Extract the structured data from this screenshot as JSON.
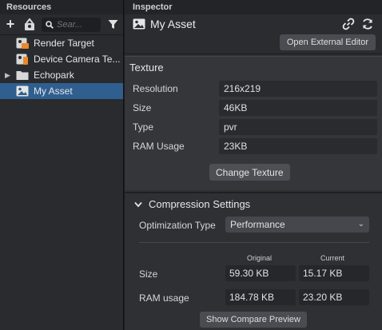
{
  "resources": {
    "title": "Resources",
    "search_placeholder": "Sear...",
    "items": [
      {
        "label": "Render Target",
        "icon": "render-target-icon",
        "selected": false
      },
      {
        "label": "Device Camera Te...",
        "icon": "device-camera-icon",
        "selected": false
      },
      {
        "label": "Echopark",
        "icon": "folder-icon",
        "selected": false,
        "expandable": true
      },
      {
        "label": "My Asset",
        "icon": "image-icon",
        "selected": true
      }
    ]
  },
  "inspector": {
    "title": "Inspector",
    "asset_name": "My Asset",
    "open_external_label": "Open External Editor",
    "texture": {
      "title": "Texture",
      "props": [
        {
          "label": "Resolution",
          "value": "216x219"
        },
        {
          "label": "Size",
          "value": "46KB"
        },
        {
          "label": "Type",
          "value": "pvr"
        },
        {
          "label": "RAM Usage",
          "value": "23KB"
        }
      ],
      "change_label": "Change Texture"
    },
    "compression": {
      "title": "Compression Settings",
      "optimization_label": "Optimization Type",
      "optimization_value": "Performance",
      "col_original": "Original",
      "col_current": "Current",
      "rows": [
        {
          "label": "Size",
          "original": "59.30 KB",
          "current": "15.17 KB"
        },
        {
          "label": "RAM usage",
          "original": "184.78 KB",
          "current": "23.20 KB"
        }
      ],
      "compare_label": "Show Compare Preview"
    }
  },
  "colors": {
    "selection": "#2f5f8f",
    "panel_bg": "#2e2f33",
    "section_bg": "#34363a",
    "field_bg": "#2a2b2f",
    "button_bg": "#4a4c52"
  }
}
